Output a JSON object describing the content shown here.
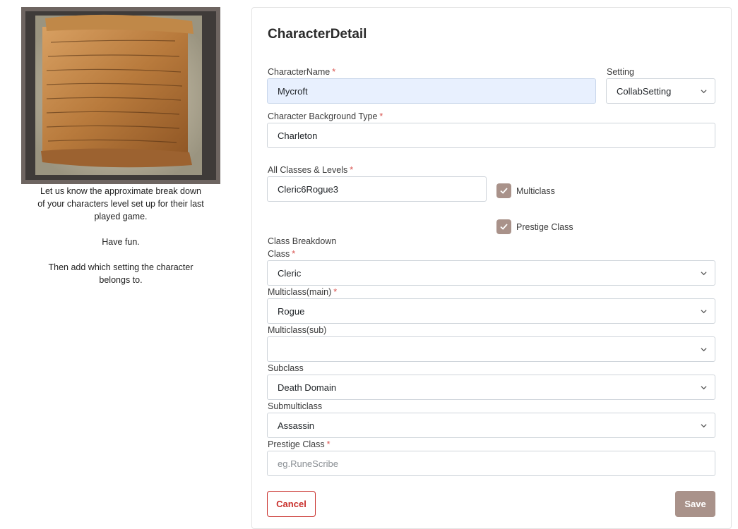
{
  "sidebar": {
    "help_para1": "Let us know the approximate break down of your characters level set up for their last played game.",
    "help_para2": "Have fun.",
    "help_para3": "Then add which setting the character belongs to."
  },
  "form": {
    "title": "CharacterDetail",
    "character_name": {
      "label": "CharacterName",
      "value": "Mycroft",
      "required": "*"
    },
    "setting": {
      "label": "Setting",
      "value": "CollabSetting"
    },
    "background_type": {
      "label": "Character Background Type",
      "value": "Charleton",
      "required": "*"
    },
    "all_classes": {
      "label": "All Classes & Levels",
      "value": "Cleric6Rogue3",
      "required": "*"
    },
    "multiclass_checkbox": {
      "label": "Multiclass",
      "checked": true
    },
    "prestige_checkbox": {
      "label": "Prestige Class",
      "checked": true
    },
    "class_breakdown_label": "Class Breakdown",
    "class": {
      "label": "Class",
      "value": "Cleric",
      "required": "*"
    },
    "multiclass_main": {
      "label": "Multiclass(main)",
      "value": "Rogue",
      "required": "*"
    },
    "multiclass_sub": {
      "label": "Multiclass(sub)",
      "value": ""
    },
    "subclass": {
      "label": "Subclass",
      "value": "Death Domain"
    },
    "submulticlass": {
      "label": "Submulticlass",
      "value": "Assassin"
    },
    "prestige_class": {
      "label": "Prestige Class",
      "placeholder": "eg.RuneScribe",
      "required": "*"
    },
    "cancel_label": "Cancel",
    "save_label": "Save"
  },
  "colors": {
    "accent": "#a9928a",
    "danger": "#c9302c",
    "required": "#d9534f"
  },
  "icons": {
    "chevron": "chevron-down-icon",
    "check": "check-icon"
  }
}
